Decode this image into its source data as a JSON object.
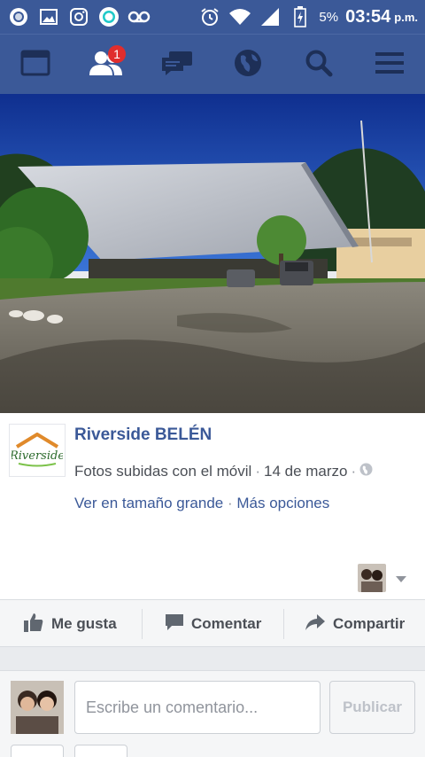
{
  "status_bar": {
    "battery": "5%",
    "time": "03:54",
    "ampm": "p.m.",
    "left_icons": [
      "circle-notification-icon",
      "image-icon",
      "instagram-icon",
      "messenger-icon",
      "voicemail-icon"
    ],
    "right_icons": [
      "alarm-icon",
      "wifi-icon",
      "signal-icon",
      "battery-icon"
    ]
  },
  "nav": {
    "items": [
      "news-feed-icon",
      "friend-requests-icon",
      "messages-icon",
      "notifications-globe-icon",
      "search-icon",
      "menu-icon"
    ],
    "friend_requests_badge": "1"
  },
  "post": {
    "page_name": "Riverside BELÉN",
    "logo_text": "Riverside",
    "source": "Fotos subidas con el móvil",
    "date": "14 de marzo",
    "view_large": "Ver en tamaño grande",
    "more_options": "Más opciones"
  },
  "actions": {
    "like": "Me gusta",
    "comment": "Comentar",
    "share": "Compartir"
  },
  "composer": {
    "placeholder": "Escribe un comentario...",
    "publish": "Publicar"
  },
  "colors": {
    "brand": "#3b5998",
    "badge": "#e02d2d",
    "text_secondary": "#4b4f56"
  }
}
